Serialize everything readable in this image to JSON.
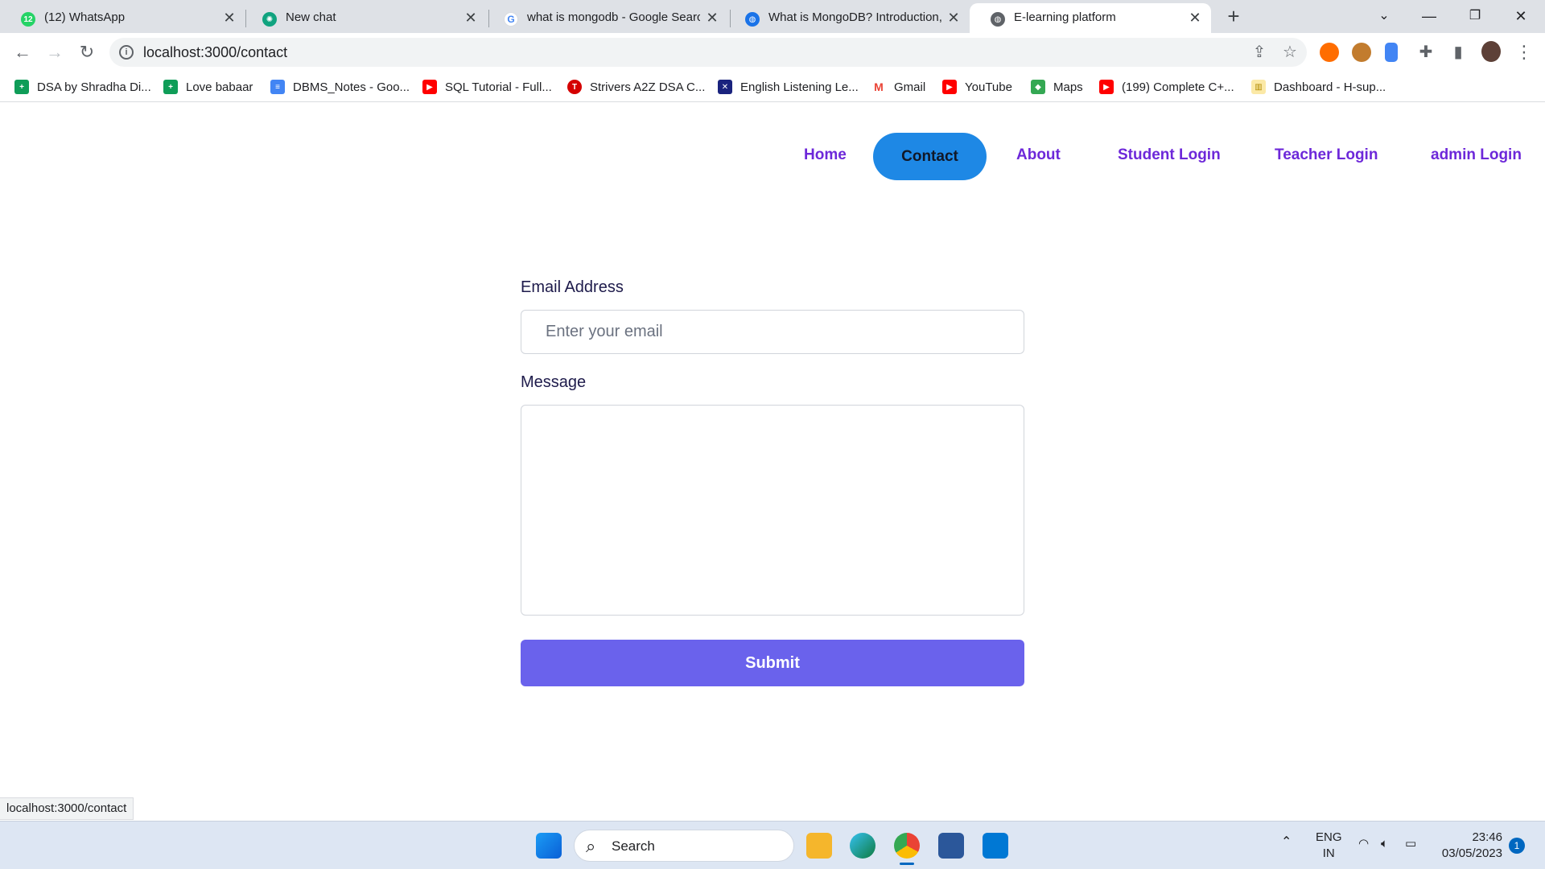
{
  "browser": {
    "tabs": [
      {
        "title": "(12) WhatsApp",
        "favicon": "whatsapp-icon",
        "badge": "12"
      },
      {
        "title": "New chat",
        "favicon": "chatgpt-icon"
      },
      {
        "title": "what is mongodb - Google Searc",
        "favicon": "google-icon"
      },
      {
        "title": "What is MongoDB? Introduction,",
        "favicon": "globe-icon"
      },
      {
        "title": "E-learning platform",
        "favicon": "globe-icon",
        "active": true
      }
    ],
    "url": "localhost:3000/contact",
    "bookmarks": [
      {
        "label": "DSA by Shradha Di...",
        "icon": "sheets-icon",
        "color": "#0f9d58"
      },
      {
        "label": "Love babaar",
        "icon": "sheets-icon",
        "color": "#0f9d58"
      },
      {
        "label": "DBMS_Notes - Goo...",
        "icon": "docs-icon",
        "color": "#4285f4"
      },
      {
        "label": "SQL Tutorial - Full...",
        "icon": "youtube-icon",
        "color": "#ff0000"
      },
      {
        "label": "Strivers A2Z DSA C...",
        "icon": "tuf-icon",
        "color": "#d50000"
      },
      {
        "label": "English Listening Le...",
        "icon": "uk-flag-icon",
        "color": "#1a237e"
      },
      {
        "label": "Gmail",
        "icon": "gmail-icon",
        "color": "#ea4335"
      },
      {
        "label": "YouTube",
        "icon": "youtube-icon",
        "color": "#ff0000"
      },
      {
        "label": "Maps",
        "icon": "maps-icon",
        "color": "#34a853"
      },
      {
        "label": "(199) Complete C+...",
        "icon": "youtube-icon",
        "color": "#ff0000"
      },
      {
        "label": "Dashboard - H-sup...",
        "icon": "dashboard-icon",
        "color": "#fbbc04"
      }
    ],
    "status_url": "localhost:3000/contact"
  },
  "nav": {
    "home": "Home",
    "contact": "Contact",
    "about": "About",
    "student_login": "Student Login",
    "teacher_login": "Teacher Login",
    "admin_login": "admin Login"
  },
  "form": {
    "email_label": "Email Address",
    "email_placeholder": "Enter your email",
    "email_value": "",
    "message_label": "Message",
    "message_value": "",
    "submit_label": "Submit"
  },
  "taskbar": {
    "search_label": "Search",
    "lang_primary": "ENG",
    "lang_secondary": "IN",
    "time": "23:46",
    "date": "03/05/2023",
    "notification_count": "1"
  },
  "colors": {
    "accent": "#6a62ec",
    "nav_link": "#6d28d9",
    "active_nav": "#1e88e5"
  }
}
